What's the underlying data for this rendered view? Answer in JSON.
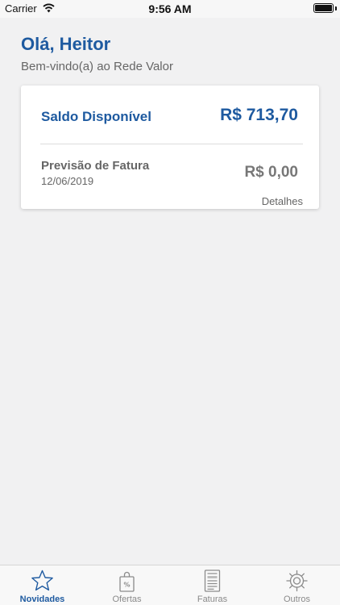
{
  "status_bar": {
    "carrier": "Carrier",
    "time": "9:56 AM"
  },
  "header": {
    "greeting": "Olá, Heitor",
    "welcome": "Bem-vindo(a) ao Rede Valor"
  },
  "card": {
    "balance_label": "Saldo Disponível",
    "balance_value": "R$ 713,70",
    "forecast_label": "Previsão de Fatura",
    "forecast_date": "12/06/2019",
    "forecast_value": "R$ 0,00",
    "details_label": "Detalhes"
  },
  "tabs": [
    {
      "label": "Novidades",
      "icon": "star-icon",
      "active": true
    },
    {
      "label": "Ofertas",
      "icon": "shopping-bag-icon",
      "active": false
    },
    {
      "label": "Faturas",
      "icon": "invoice-icon",
      "active": false
    },
    {
      "label": "Outros",
      "icon": "gear-icon",
      "active": false
    }
  ],
  "colors": {
    "primary": "#1e5aa0",
    "muted": "#666666",
    "background": "#f1f1f2",
    "inactive": "#8a8a8a"
  }
}
